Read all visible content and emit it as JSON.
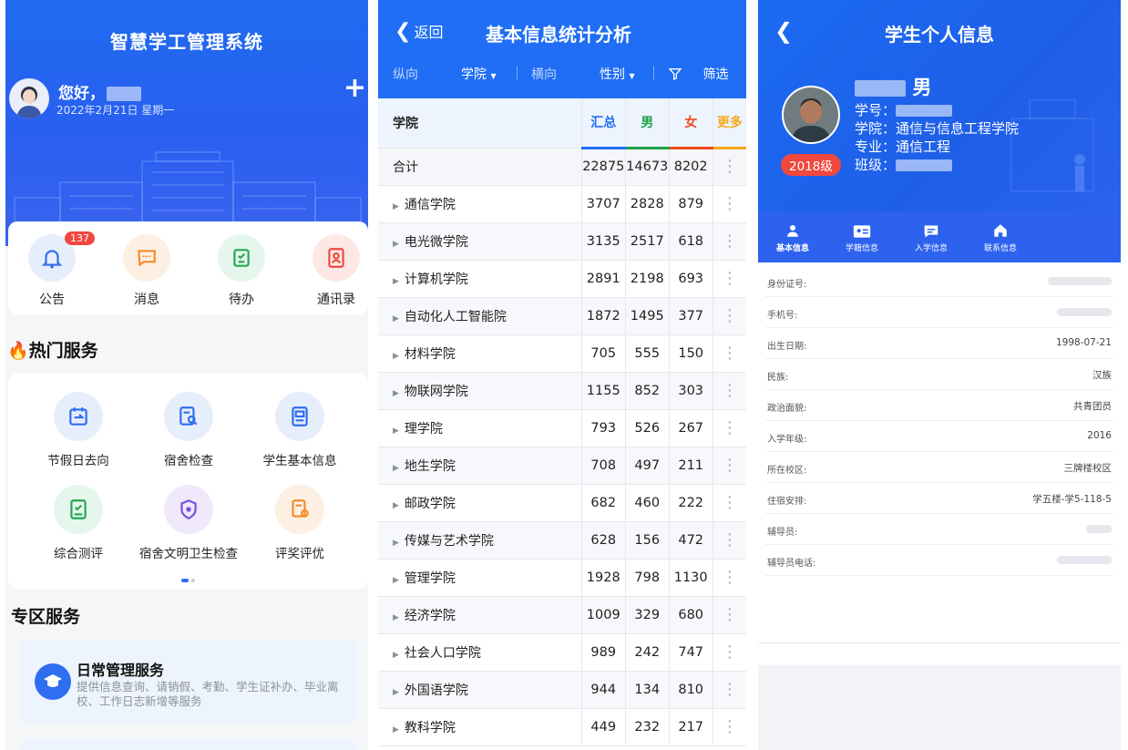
{
  "home": {
    "title": "智慧学工管理系统",
    "greeting": "您好，",
    "date": "2022年2月21日 星期一",
    "plus": "+",
    "quick": [
      {
        "label": "公告",
        "icon": "bell-icon",
        "badge": "137"
      },
      {
        "label": "消息",
        "icon": "message-icon"
      },
      {
        "label": "待办",
        "icon": "todo-icon"
      },
      {
        "label": "通讯录",
        "icon": "contacts-icon"
      }
    ],
    "hot_title": "热门服务",
    "services": [
      {
        "label": "节假日去向",
        "icon": "calendar-icon"
      },
      {
        "label": "宿舍检查",
        "icon": "inspection-icon"
      },
      {
        "label": "学生基本信息",
        "icon": "student-info-icon"
      },
      {
        "label": "综合测评",
        "icon": "evaluation-icon"
      },
      {
        "label": "宿舍文明卫生检查",
        "icon": "shield-icon"
      },
      {
        "label": "评奖评优",
        "icon": "award-icon"
      }
    ],
    "zone_title": "专区服务",
    "card": {
      "title": "日常管理服务",
      "desc": "提供信息查询、请销假、考勤、学生证补办、毕业离校、工作日志新增等服务"
    }
  },
  "stats": {
    "back": "返回",
    "title": "基本信息统计分析",
    "filters": {
      "vertical": "纵向",
      "vertical_value": "学院",
      "horizontal": "横向",
      "horizontal_value": "性别",
      "filter": "筛选"
    },
    "headers": {
      "name": "学院",
      "sum": "汇总",
      "male": "男",
      "female": "女",
      "more": "更多"
    },
    "total": {
      "name": "合计",
      "sum": "22875",
      "male": "14673",
      "female": "8202"
    },
    "rows": [
      {
        "name": "通信学院",
        "sum": "3707",
        "male": "2828",
        "female": "879"
      },
      {
        "name": "电光微学院",
        "sum": "3135",
        "male": "2517",
        "female": "618"
      },
      {
        "name": "计算机学院",
        "sum": "2891",
        "male": "2198",
        "female": "693"
      },
      {
        "name": "自动化人工智能院",
        "sum": "1872",
        "male": "1495",
        "female": "377"
      },
      {
        "name": "材料学院",
        "sum": "705",
        "male": "555",
        "female": "150"
      },
      {
        "name": "物联网学院",
        "sum": "1155",
        "male": "852",
        "female": "303"
      },
      {
        "name": "理学院",
        "sum": "793",
        "male": "526",
        "female": "267"
      },
      {
        "name": "地生学院",
        "sum": "708",
        "male": "497",
        "female": "211"
      },
      {
        "name": "邮政学院",
        "sum": "682",
        "male": "460",
        "female": "222"
      },
      {
        "name": "传媒与艺术学院",
        "sum": "628",
        "male": "156",
        "female": "472"
      },
      {
        "name": "管理学院",
        "sum": "1928",
        "male": "798",
        "female": "1130"
      },
      {
        "name": "经济学院",
        "sum": "1009",
        "male": "329",
        "female": "680"
      },
      {
        "name": "社会人口学院",
        "sum": "989",
        "male": "242",
        "female": "747"
      },
      {
        "name": "外国语学院",
        "sum": "944",
        "male": "134",
        "female": "810"
      },
      {
        "name": "教科学院",
        "sum": "449",
        "male": "232",
        "female": "217"
      }
    ]
  },
  "profile": {
    "title": "学生个人信息",
    "name_suffix": "男",
    "grade": "2018级",
    "student_no_label": "学号：",
    "college_label": "学院：",
    "college": "通信与信息工程学院",
    "major_label": "专业：",
    "major": "通信工程",
    "class_label": "班级：",
    "tabs": [
      "基本信息",
      "学籍信息",
      "入学信息",
      "联系信息"
    ],
    "info": [
      {
        "label": "身份证号:",
        "value": ""
      },
      {
        "label": "手机号:",
        "value": ""
      },
      {
        "label": "出生日期:",
        "value": "1998-07-21"
      },
      {
        "label": "民族:",
        "value": "汉族"
      },
      {
        "label": "政治面貌:",
        "value": "共青团员"
      },
      {
        "label": "入学年级:",
        "value": "2016"
      },
      {
        "label": "所在校区:",
        "value": "三牌楼校区"
      },
      {
        "label": "住宿安排:",
        "value": "学五楼-学5-118-5"
      },
      {
        "label": "辅导员:",
        "value": ""
      },
      {
        "label": "辅导员电话:",
        "value": ""
      }
    ]
  }
}
